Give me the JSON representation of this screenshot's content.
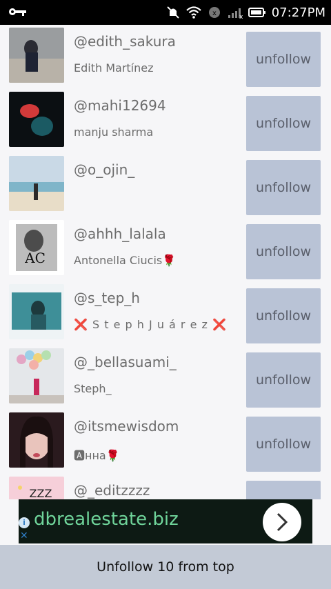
{
  "status_bar": {
    "time": "07:27PM",
    "icons": [
      "key-icon",
      "mute-icon",
      "wifi-icon",
      "sync-icon",
      "signal-icon",
      "battery-icon"
    ]
  },
  "users": [
    {
      "handle": "@edith_sakura",
      "name": "Edith Martínez"
    },
    {
      "handle": "@mahi12694",
      "name": "manju sharma"
    },
    {
      "handle": "@o_ojin_",
      "name": ""
    },
    {
      "handle": "@ahhh_lalala",
      "name": "Antonella Ciucis🌹"
    },
    {
      "handle": "@s_tep_h",
      "name": "❌ S t e p h  J u á r e z ❌"
    },
    {
      "handle": "@_bellasuami_",
      "name": "Steph_"
    },
    {
      "handle": "@itsmewisdom",
      "name": "🅰нна🌹"
    },
    {
      "handle": "@_editzzzz",
      "name": ""
    }
  ],
  "unfollow_label": "unfollow",
  "ad": {
    "text": "dbrealestate.biz",
    "info_icon": "info-icon",
    "close_icon": "close-icon",
    "arrow_icon": "chevron-right-icon"
  },
  "bottom_button": "Unfollow 10 from top",
  "colors": {
    "button_bg": "#b9c3d6",
    "bottom_bg": "#c3cad6",
    "ad_text": "#6fd49a"
  }
}
